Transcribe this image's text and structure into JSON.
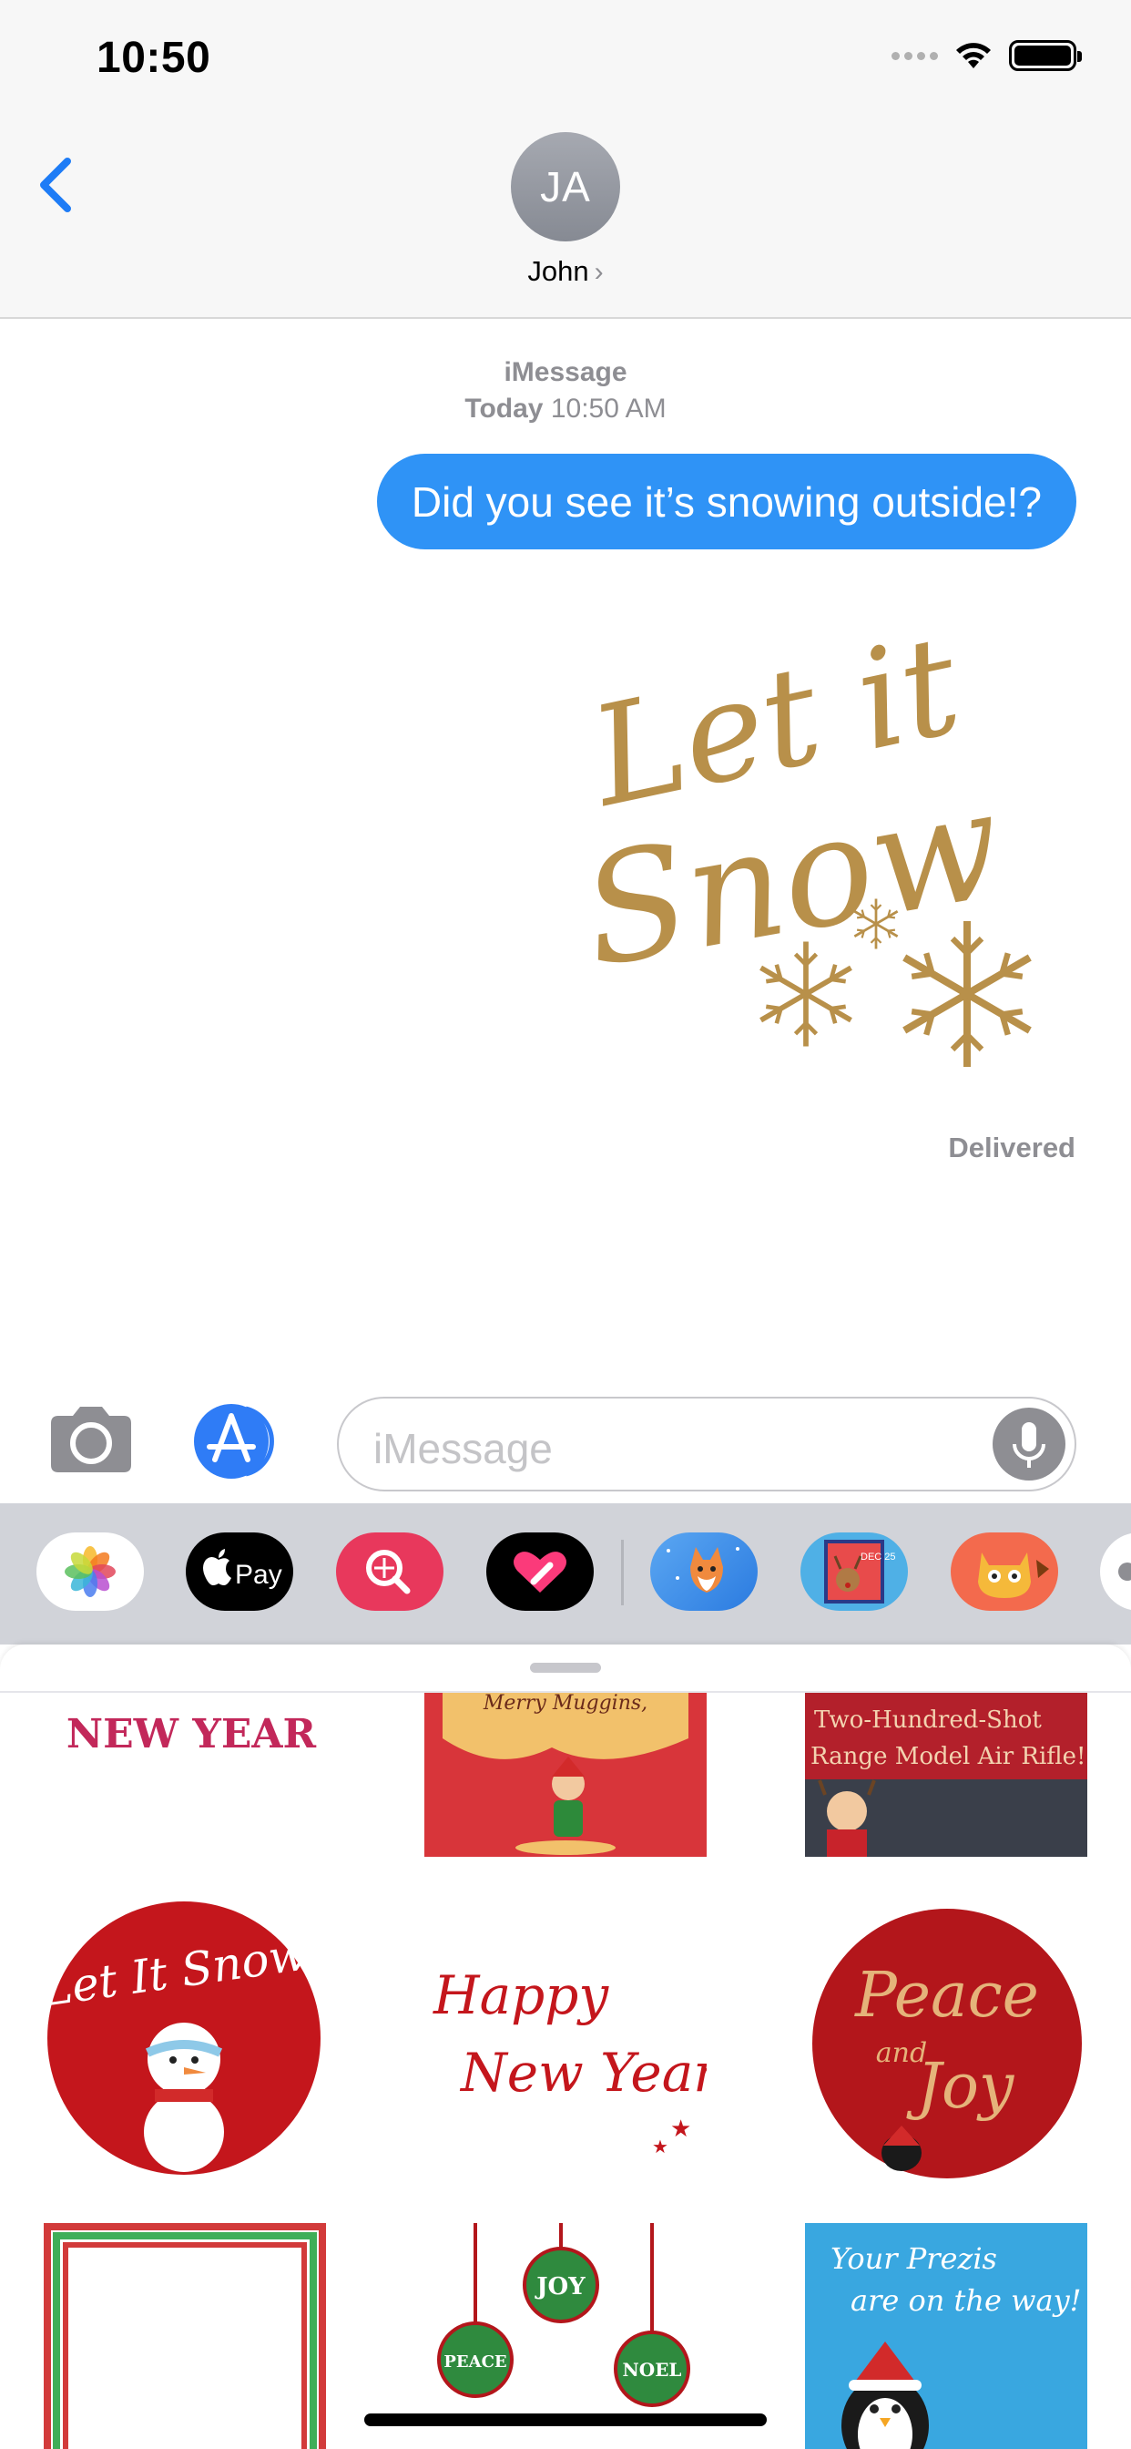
{
  "status_bar": {
    "time": "10:50"
  },
  "header": {
    "avatar_initials": "JA",
    "contact_name": "John",
    "chevron": "›"
  },
  "conversation": {
    "service": "iMessage",
    "timestamp_day": "Today",
    "timestamp_time": "10:50 AM",
    "sent_message": "Did you see it’s snowing outside!?",
    "sticker_text_line1": "Let it",
    "sticker_text_line2": "Snow",
    "delivery_status": "Delivered"
  },
  "input": {
    "placeholder": "iMessage"
  },
  "app_drawer": {
    "apps": [
      {
        "name": "Photos",
        "icon": "photos-icon"
      },
      {
        "name": "Apple Pay",
        "label": "Pay",
        "icon": "apple-pay-icon"
      },
      {
        "name": "Search Images",
        "icon": "images-search-icon"
      },
      {
        "name": "Digital Touch",
        "icon": "digital-touch-icon"
      },
      {
        "name": "Sticker App Fox",
        "icon": "fox-sticker-icon"
      },
      {
        "name": "Sticker App Reindeer",
        "label": "DEC 25",
        "icon": "reindeer-sticker-icon"
      },
      {
        "name": "Sticker App Cat",
        "icon": "cat-sticker-icon"
      }
    ]
  },
  "stickers": {
    "row1": {
      "new_year": "NEW YEAR",
      "merry": "Merry Muggins,",
      "rifle_line1": "Two-Hundred-Shot",
      "rifle_line2": "Range Model Air Rifle!"
    },
    "row2": {
      "let_it_snow": "Let It Snow!",
      "happy": "Happy",
      "new_year": "New Year",
      "peace": "Peace",
      "and": "and",
      "joy": "Joy"
    },
    "row3": {
      "prezis_line1": "Your Prezis",
      "prezis_line2": "are on the way!",
      "ornament1": "JOY",
      "ornament2": "PEACE",
      "ornament3": "NOEL"
    }
  },
  "colors": {
    "accent_blue": "#2f93f6",
    "sticker_red": "#b3161b",
    "sticker_gold": "#c79a4a",
    "gray_text": "#8e8e93"
  }
}
